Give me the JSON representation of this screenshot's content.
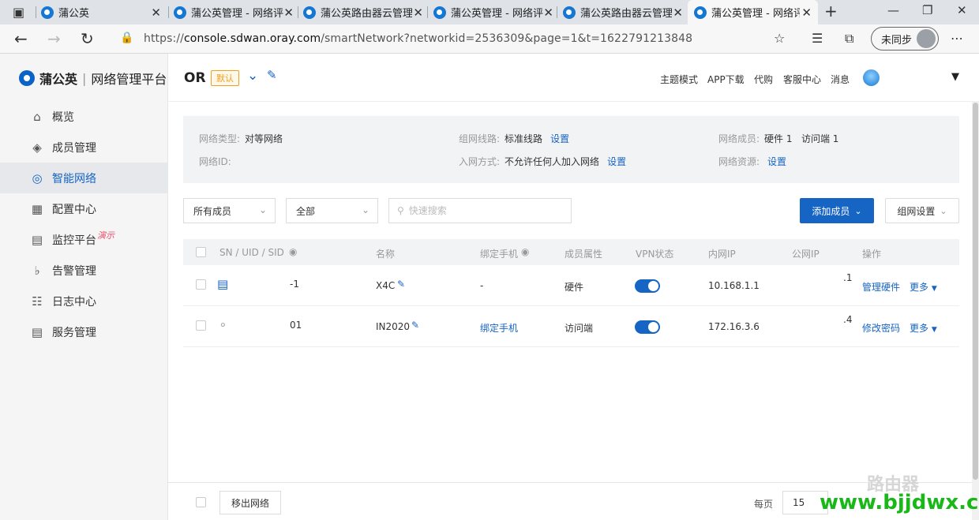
{
  "browser": {
    "tabs": [
      {
        "title": "蒲公英",
        "active": false
      },
      {
        "title": "蒲公英管理 - 网络评",
        "active": false
      },
      {
        "title": "蒲公英路由器云管理",
        "active": false
      },
      {
        "title": "蒲公英管理 - 网络评",
        "active": false
      },
      {
        "title": "蒲公英路由器云管理",
        "active": false
      },
      {
        "title": "蒲公英管理 - 网络评",
        "active": true
      }
    ],
    "url_prefix": "https://",
    "url_host": "console.sdwan.oray.com",
    "url_path": "/smartNetwork?networkid=2536309&page=1&t=1622791213848",
    "sync_label": "未同步"
  },
  "sidebar": {
    "brand": "蒲公英",
    "brand_sep": "|",
    "brand_sub": "网络管理平台",
    "items": [
      {
        "label": "概览",
        "icon": "home-icon"
      },
      {
        "label": "成员管理",
        "icon": "layers-icon"
      },
      {
        "label": "智能网络",
        "icon": "network-icon",
        "active": true
      },
      {
        "label": "配置中心",
        "icon": "grid-icon"
      },
      {
        "label": "监控平台",
        "icon": "monitor-icon",
        "badge": "演示"
      },
      {
        "label": "告警管理",
        "icon": "bell-icon"
      },
      {
        "label": "日志中心",
        "icon": "clipboard-icon"
      },
      {
        "label": "服务管理",
        "icon": "document-icon"
      }
    ]
  },
  "header": {
    "network_name": "OR",
    "default_tag": "默认",
    "links": [
      "主题模式",
      "APP下载",
      "代购",
      "客服中心",
      "消息"
    ]
  },
  "info": {
    "type_label": "网络类型:",
    "type_value": "对等网络",
    "id_label": "网络ID:",
    "line_label": "组网线路:",
    "line_value": "标准线路",
    "line_link": "设置",
    "join_label": "入网方式:",
    "join_value": "不允许任何人加入网络",
    "join_link": "设置",
    "members_label": "网络成员:",
    "members_value": "硬件 1   访问端 1",
    "resources_label": "网络资源:",
    "resources_link": "设置"
  },
  "filters": {
    "members": "所有成员",
    "status": "全部",
    "search_placeholder": "快速搜索",
    "add_member": "添加成员",
    "network_settings": "组网设置"
  },
  "table": {
    "headers": [
      "SN / UID / SID",
      "名称",
      "绑定手机",
      "成员属性",
      "VPN状态",
      "内网IP",
      "公网IP",
      "操作"
    ],
    "rows": [
      {
        "sn": "-1",
        "name": "X4C",
        "phone": "-",
        "type": "硬件",
        "vpn_on": true,
        "lan_ip": "10.168.1.1",
        "wan_ip": ".1",
        "action": "管理硬件",
        "more": "更多"
      },
      {
        "sn": "01",
        "name": "IN2020",
        "phone": "绑定手机",
        "type": "访问端",
        "vpn_on": true,
        "lan_ip": "172.16.3.6",
        "wan_ip": ".4",
        "action": "修改密码",
        "more": "更多"
      }
    ]
  },
  "footer": {
    "move_out": "移出网络",
    "per_page_label": "每页",
    "per_page_value": "15"
  },
  "watermark": {
    "text": "www.bjjdwx.com",
    "logo_text": "路由器"
  },
  "colors": {
    "accent": "#1664c4",
    "warning": "#f0a020",
    "watermark": "#17b817"
  }
}
